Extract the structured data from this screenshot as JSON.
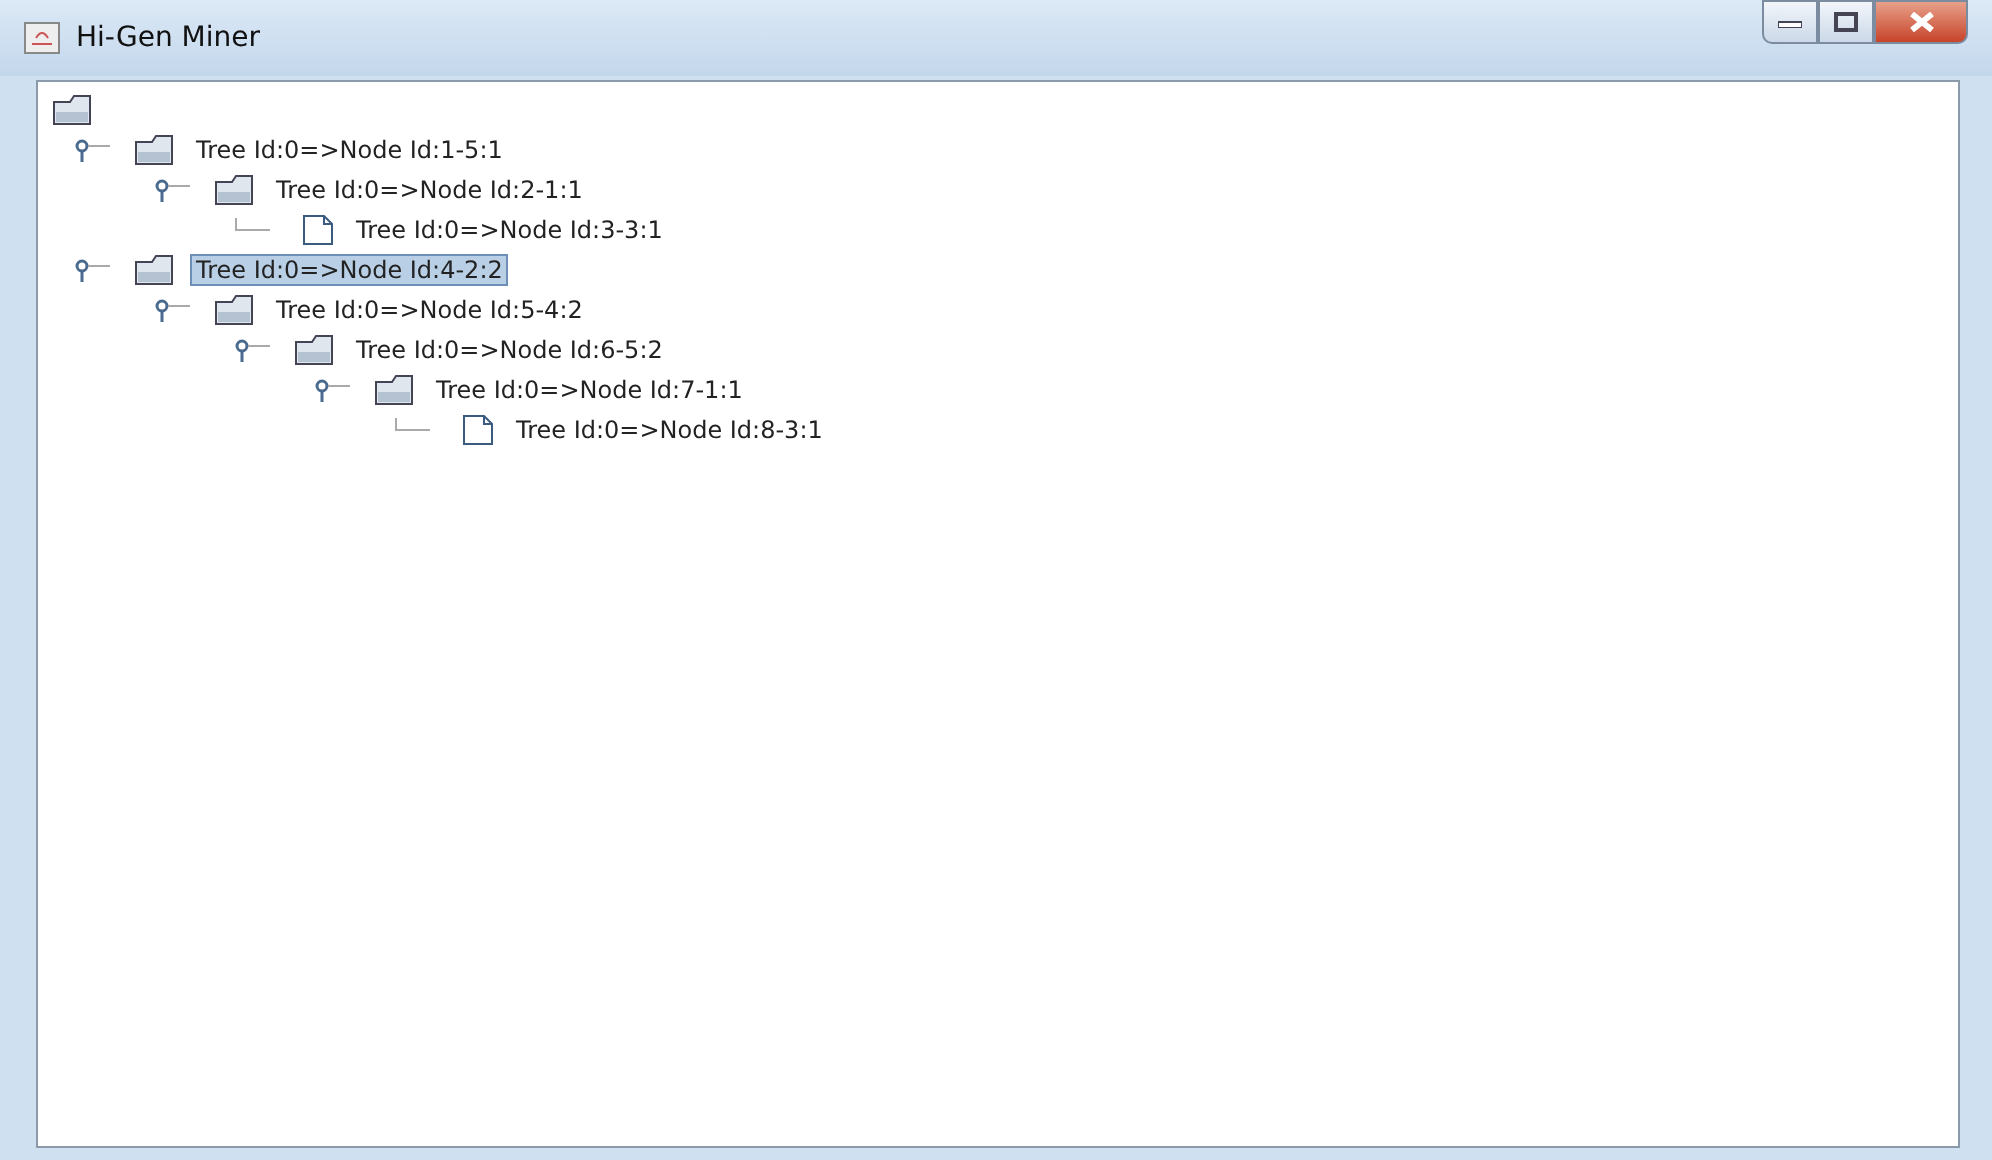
{
  "window": {
    "title": "Hi-Gen Miner"
  },
  "tree": {
    "kind": "folder",
    "expanded": true,
    "children": [
      {
        "label": "Tree Id:0=>Node Id:1-5:1",
        "kind": "folder",
        "expanded": true,
        "selected": false,
        "children": [
          {
            "label": "Tree Id:0=>Node Id:2-1:1",
            "kind": "folder",
            "expanded": true,
            "selected": false,
            "children": [
              {
                "label": "Tree Id:0=>Node Id:3-3:1",
                "kind": "file",
                "selected": false
              }
            ]
          }
        ]
      },
      {
        "label": "Tree Id:0=>Node Id:4-2:2",
        "kind": "folder",
        "expanded": true,
        "selected": true,
        "children": [
          {
            "label": "Tree Id:0=>Node Id:5-4:2",
            "kind": "folder",
            "expanded": true,
            "selected": false,
            "children": [
              {
                "label": "Tree Id:0=>Node Id:6-5:2",
                "kind": "folder",
                "expanded": true,
                "selected": false,
                "children": [
                  {
                    "label": "Tree Id:0=>Node Id:7-1:1",
                    "kind": "folder",
                    "expanded": true,
                    "selected": false,
                    "children": [
                      {
                        "label": "Tree Id:0=>Node Id:8-3:1",
                        "kind": "file",
                        "selected": false
                      }
                    ]
                  }
                ]
              }
            ]
          }
        ]
      }
    ]
  }
}
